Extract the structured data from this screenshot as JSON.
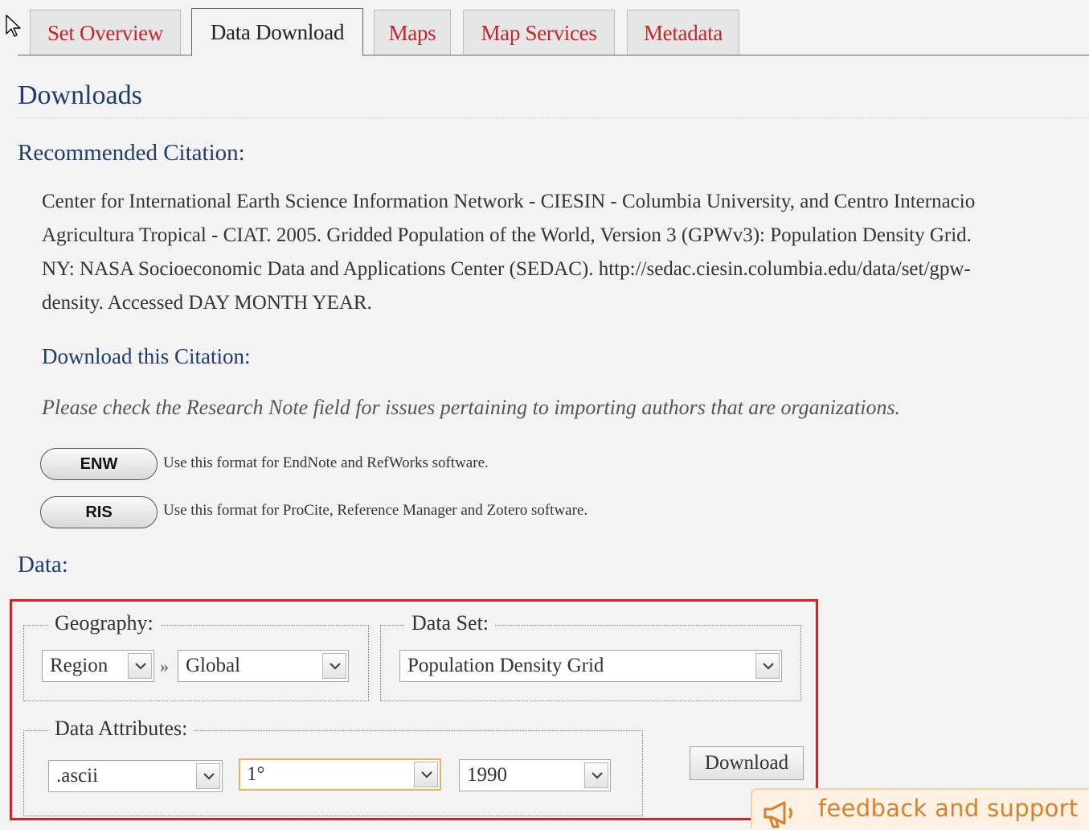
{
  "tabs": [
    {
      "label": "Set Overview",
      "active": false
    },
    {
      "label": "Data Download",
      "active": true
    },
    {
      "label": "Maps",
      "active": false
    },
    {
      "label": "Map Services",
      "active": false
    },
    {
      "label": "Metadata",
      "active": false
    }
  ],
  "downloads": {
    "heading": "Downloads",
    "citation_heading": "Recommended Citation:",
    "citation_lines": [
      "Center for International Earth Science Information Network - CIESIN - Columbia University, and Centro Internacio",
      "Agricultura Tropical - CIAT. 2005. Gridded Population of the World, Version 3 (GPWv3): Population Density Grid.",
      "NY: NASA Socioeconomic Data and Applications Center (SEDAC). http://sedac.ciesin.columbia.edu/data/set/gpw-",
      "density. Accessed DAY MONTH YEAR."
    ],
    "download_citation_heading": "Download this Citation:",
    "note": "Please check the Research Note field for issues pertaining to importing authors that are organizations.",
    "formats": [
      {
        "label": "ENW",
        "description": "Use this format for EndNote and RefWorks software."
      },
      {
        "label": "RIS",
        "description": "Use this format for ProCite, Reference Manager and Zotero software."
      }
    ]
  },
  "data": {
    "heading": "Data:",
    "geography": {
      "legend": "Geography:",
      "type_value": "Region",
      "separator": "»",
      "region_value": "Global"
    },
    "dataset": {
      "legend": "Data Set:",
      "value": "Population Density Grid"
    },
    "attributes": {
      "legend": "Data Attributes:",
      "format_value": ".ascii",
      "resolution_value": "1°",
      "year_value": "1990"
    },
    "download_label": "Download"
  },
  "feedback": {
    "label": "feedback and support",
    "icon": "megaphone-icon",
    "color": "#d9812a"
  },
  "colors": {
    "tab_link": "#c0272d",
    "heading": "#1f3c6b",
    "highlight_border": "#e51b24"
  }
}
